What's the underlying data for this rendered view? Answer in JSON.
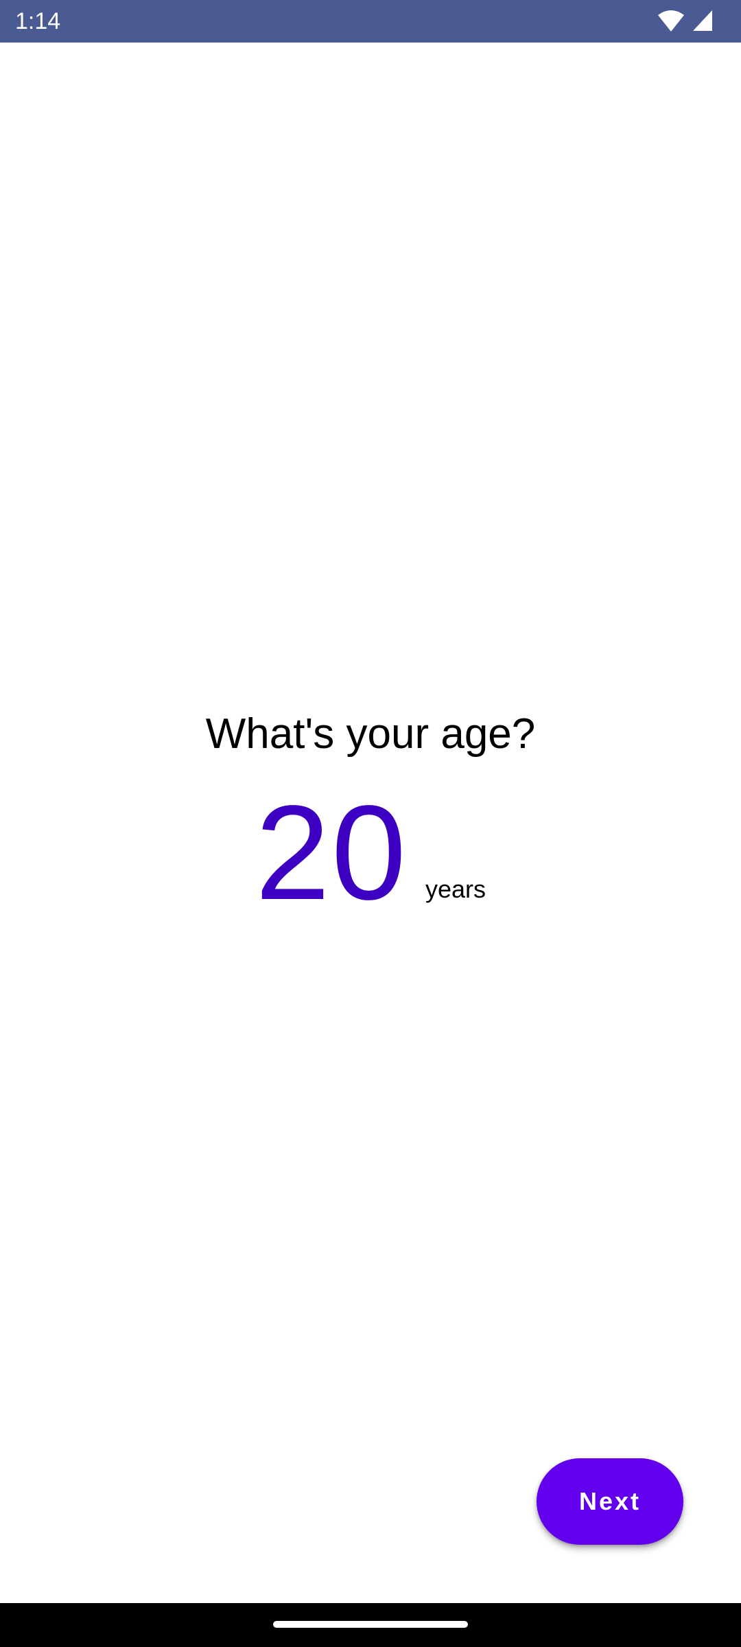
{
  "status_bar": {
    "time": "1:14",
    "icons": [
      "wifi-icon",
      "cell-signal-icon"
    ]
  },
  "screen": {
    "question": "What's your age?",
    "age_value": "20",
    "age_unit": "years"
  },
  "actions": {
    "next_label": "Next"
  },
  "colors": {
    "status_bar": "#4a5b94",
    "age_value": "#3d00c2",
    "accent": "#6200ee",
    "background": "#ffffff"
  }
}
